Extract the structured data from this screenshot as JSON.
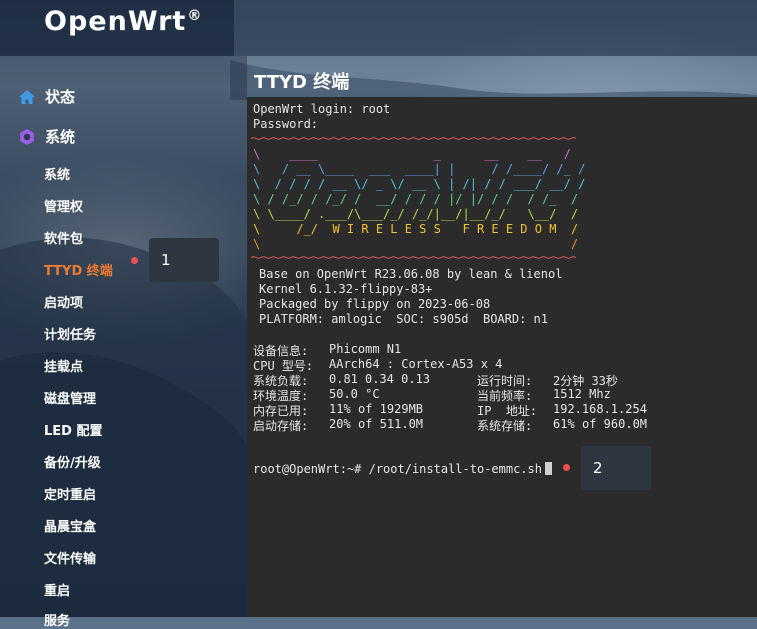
{
  "header": {
    "brand": "OpenWrt",
    "reg": "®"
  },
  "sidebar": {
    "status": {
      "label": "状态",
      "icon": "home-icon"
    },
    "system": {
      "label": "系统",
      "icon": "gear-icon"
    },
    "items": [
      "系统",
      "管理权",
      "软件包",
      "TTYD 终端",
      "启动项",
      "计划任务",
      "挂载点",
      "磁盘管理",
      "LED 配置",
      "备份/升级",
      "定时重启",
      "晶晨宝盒",
      "文件传输",
      "重启",
      "服务"
    ],
    "active_item": "TTYD 终端"
  },
  "page": {
    "title": "TTYD 终端"
  },
  "terminal": {
    "login": "OpenWrt login: root",
    "password": "Password:",
    "banner": [
      "\\    ____                _      __    __   /",
      "\\   / __ \\____  ___  ____| |     / /____/ /_ /",
      "\\  / / / / __ \\/ _ \\/ __ \\ | /| / / ___/ __/ /",
      "\\ / /_/ / /_/ /  __/ / / / |/ |/ / /  / /_  /",
      "\\ \\____/ .___/\\___/_/ /_/|__/|__/_/   \\__/  /",
      "\\     /_/  W I R E L E S S   F R E E D O M  /",
      "\\                                           /"
    ],
    "info": [
      "Base on OpenWrt R23.06.08 by lean & lienol",
      "Kernel 6.1.32-flippy-83+",
      "Packaged by flippy on 2023-06-08",
      "PLATFORM: amlogic  SOC: s905d  BOARD: n1"
    ],
    "device": {
      "label": "设备信息:",
      "value": "Phicomm N1"
    },
    "cpu": {
      "label": "CPU 型号:",
      "value": "AArch64 : Cortex-A53 x 4"
    },
    "load": {
      "label": "系统负载:",
      "v1": "0.81",
      "v2": "0.34 0.13"
    },
    "uptime": {
      "label": "运行时间:",
      "value": "2分钟 33秒"
    },
    "temp": {
      "label": "环境温度:",
      "value": "50.0 °C"
    },
    "freq": {
      "label": "当前频率:",
      "value": "1512 Mhz"
    },
    "mem": {
      "label": "内存已用:",
      "pct": "11%",
      "rest": "of 1929MB"
    },
    "ip": {
      "label": "IP  地址:",
      "value": "192.168.1.254"
    },
    "boot": {
      "label": "启动存储:",
      "pct": "20%",
      "rest": "of 511.0M"
    },
    "sys": {
      "label": "系统存储:",
      "pct": "61%",
      "rest": "of 960.0M"
    },
    "prompt": "root@OpenWrt:~# /root/install-to-emmc.sh"
  },
  "callouts": [
    "1",
    "2"
  ],
  "colors": {
    "accent": "#f07b30",
    "green": "#8fd14f",
    "yellow": "#ffd93d",
    "red": "#ff4d4d",
    "marker": "#ee5050"
  }
}
